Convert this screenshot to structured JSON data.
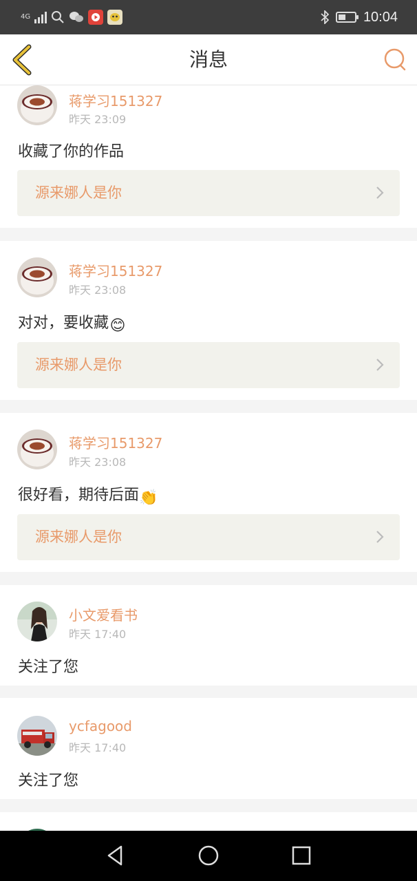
{
  "status_bar": {
    "network": "4G",
    "time": "10:04",
    "battery_level": 0.45,
    "icons": [
      "signal-icon",
      "search-icon",
      "wechat-icon",
      "video-app-icon",
      "game-app-icon",
      "bluetooth-icon",
      "battery-icon"
    ]
  },
  "header": {
    "title": "消息",
    "back_icon": "chevron-left-icon",
    "search_icon": "search-icon"
  },
  "colors": {
    "accent": "#e89a6a",
    "back_chevron": "#e8c23a",
    "work_bg": "#f2f2ec",
    "separator": "#f4f4f4"
  },
  "messages": [
    {
      "user": "蒋学习151327",
      "time": "昨天 23:09",
      "text": "收藏了你的作品",
      "emoji": "",
      "work_title": "源来娜人是你",
      "avatar": "coffee-cup-avatar"
    },
    {
      "user": "蒋学习151327",
      "time": "昨天 23:08",
      "text": "对对，要收藏",
      "emoji": "😊",
      "work_title": "源来娜人是你",
      "avatar": "coffee-cup-avatar"
    },
    {
      "user": "蒋学习151327",
      "time": "昨天 23:08",
      "text": "很好看，期待后面",
      "emoji": "👏",
      "work_title": "源来娜人是你",
      "avatar": "coffee-cup-avatar"
    },
    {
      "user": "小文爱看书",
      "time": "昨天 17:40",
      "text": "关注了您",
      "avatar": "person-photo-avatar"
    },
    {
      "user": "ycfagood",
      "time": "昨天 17:40",
      "text": "关注了您",
      "avatar": "fire-truck-avatar"
    }
  ],
  "nav_bar": {
    "icons": [
      "back-triangle-icon",
      "home-circle-icon",
      "recents-square-icon"
    ]
  }
}
